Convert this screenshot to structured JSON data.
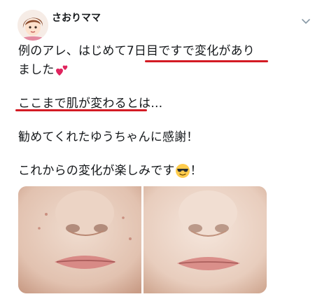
{
  "tweet": {
    "username": "さおりママ",
    "lines": [
      {
        "before": "例のアレ、はじめて",
        "highlight": "7日目ですで変化",
        "after": "があり"
      },
      {
        "text": "ました"
      },
      {
        "highlight": "ここまで肌が変わる",
        "after": "とは…"
      },
      {
        "text": "勧めてくれたゆうちゃんに感謝！"
      },
      {
        "before": "これからの変化が楽しみです",
        "after": "！"
      }
    ]
  },
  "icons": {
    "avatar": "cartoon-avatar",
    "menu": "chevron-down-icon",
    "heart": "two-hearts-icon",
    "emoji": "sunglasses-face-icon"
  },
  "colors": {
    "underline": "#d31b24",
    "heart": "#e0245e",
    "text": "#14171a"
  }
}
